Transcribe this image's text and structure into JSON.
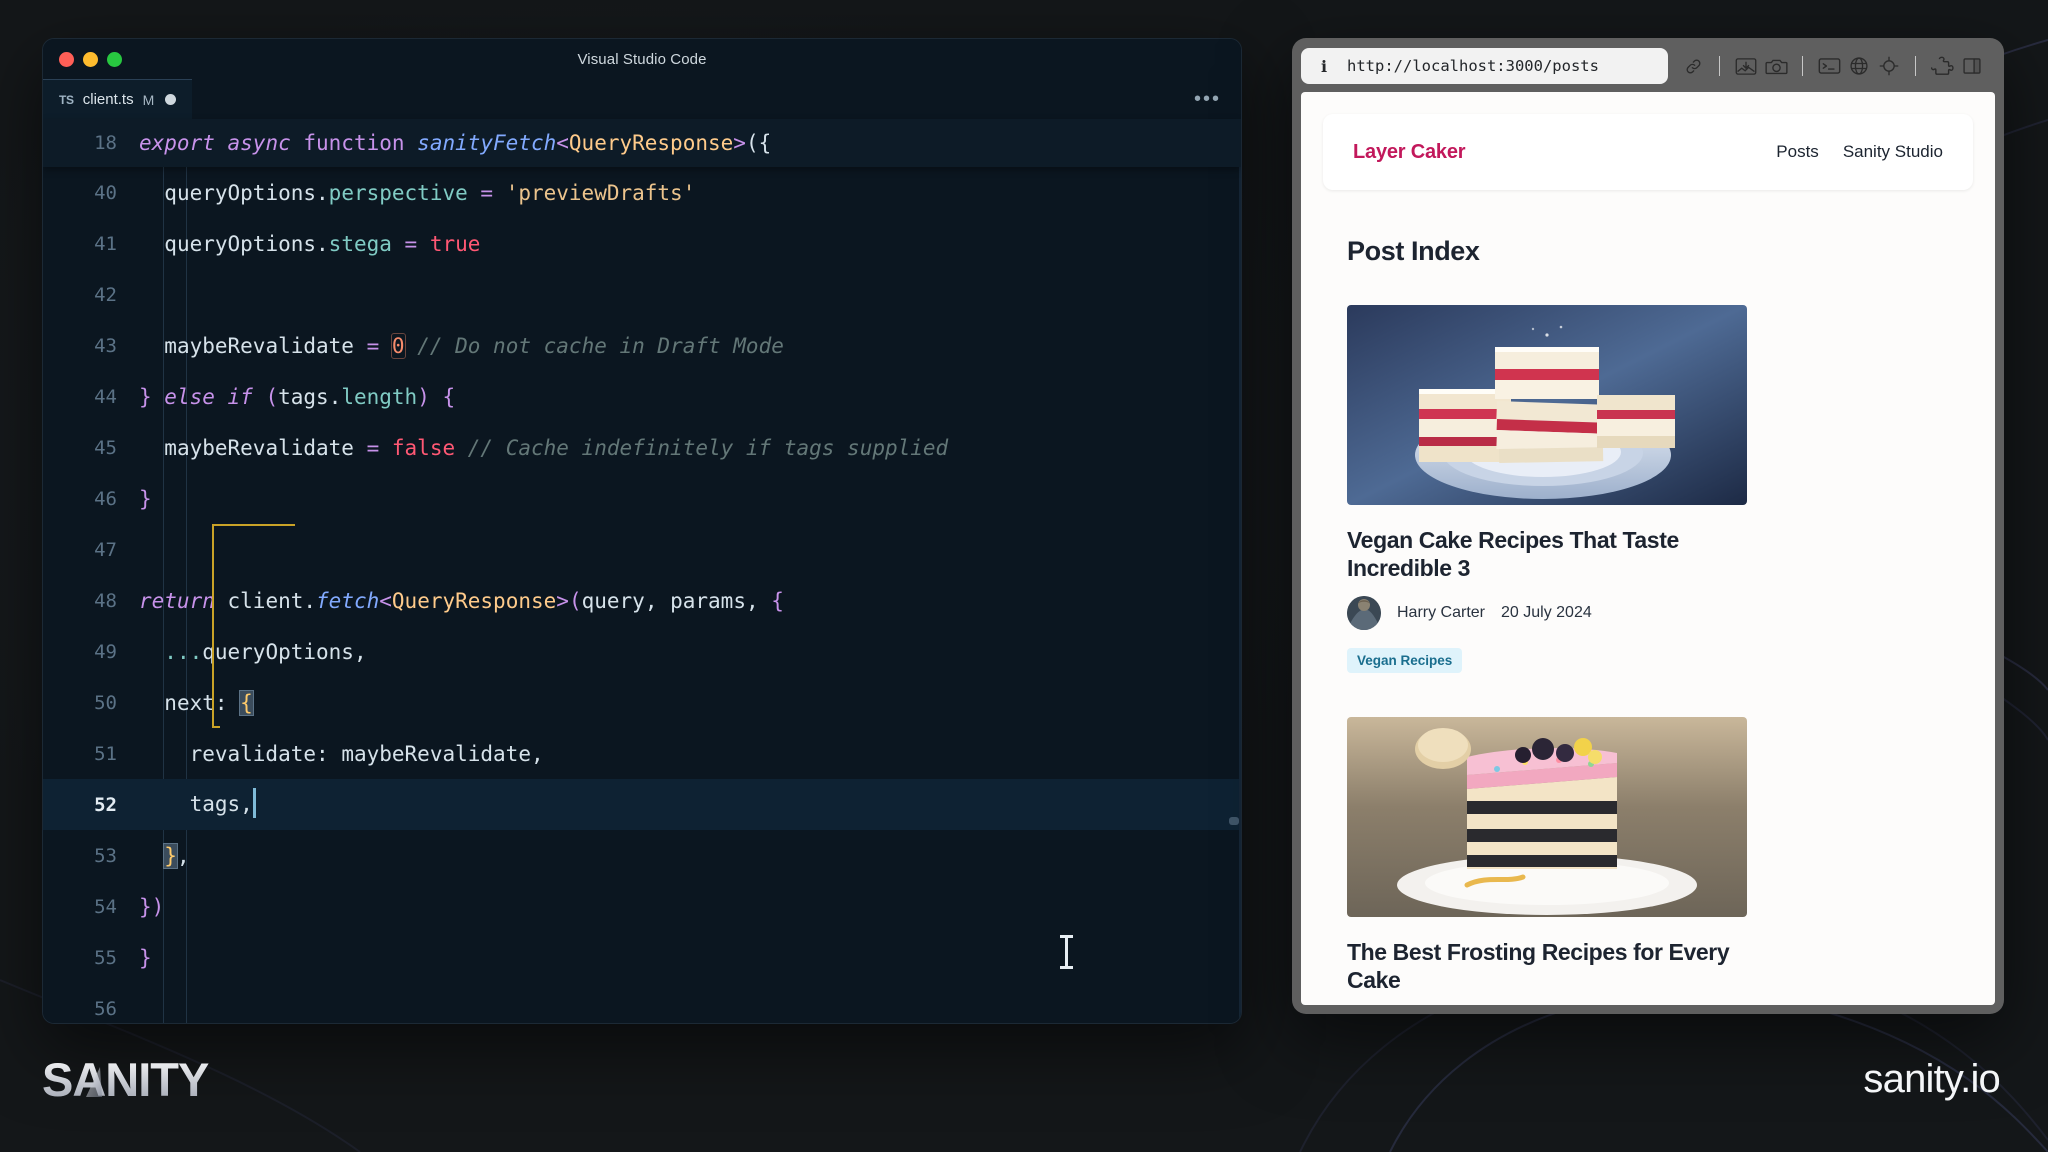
{
  "window": {
    "vscode_title": "Visual Studio Code",
    "traffic_lights": [
      "close-button",
      "minimize-button",
      "maximize-button"
    ],
    "tab": {
      "file_icon_label": "TS",
      "filename": "client.ts",
      "modified_badge": "M",
      "dirty_indicator": "●"
    },
    "tab_actions_label": "•••"
  },
  "editor": {
    "sticky": {
      "line_number": "18",
      "tokens": [
        {
          "t": "export ",
          "c": "k-kw"
        },
        {
          "t": "async ",
          "c": "k-kw"
        },
        {
          "t": "function ",
          "c": "k-kw2"
        },
        {
          "t": "sanityFetch",
          "c": "k-fn"
        },
        {
          "t": "<",
          "c": "k-pink"
        },
        {
          "t": "QueryResponse",
          "c": "k-type"
        },
        {
          "t": ">",
          "c": "k-pink"
        },
        {
          "t": "({",
          "c": "k-punct"
        }
      ]
    },
    "lines": [
      {
        "n": "40",
        "active": false,
        "tokens": [
          {
            "t": "  ",
            "c": "k-white"
          },
          {
            "t": "queryOptions",
            "c": "k-white"
          },
          {
            "t": ".",
            "c": "k-punct"
          },
          {
            "t": "perspective",
            "c": "k-member"
          },
          {
            "t": " = ",
            "c": "k-op"
          },
          {
            "t": "'previewDrafts'",
            "c": "k-str"
          }
        ]
      },
      {
        "n": "41",
        "active": false,
        "tokens": [
          {
            "t": "  ",
            "c": "k-white"
          },
          {
            "t": "queryOptions",
            "c": "k-white"
          },
          {
            "t": ".",
            "c": "k-punct"
          },
          {
            "t": "stega",
            "c": "k-member"
          },
          {
            "t": " = ",
            "c": "k-op"
          },
          {
            "t": "true",
            "c": "k-bool"
          }
        ]
      },
      {
        "n": "42",
        "active": false,
        "tokens": []
      },
      {
        "n": "43",
        "active": false,
        "tokens": [
          {
            "t": "  ",
            "c": "k-white"
          },
          {
            "t": "maybeRevalidate",
            "c": "k-white"
          },
          {
            "t": " = ",
            "c": "k-op"
          },
          {
            "t": "0",
            "c": "k-num num-box"
          },
          {
            "t": " ",
            "c": "k-white"
          },
          {
            "t": "// Do not cache in Draft Mode",
            "c": "k-cmt"
          }
        ]
      },
      {
        "n": "44",
        "active": false,
        "tokens": [
          {
            "t": "} ",
            "c": "k-pink"
          },
          {
            "t": "else ",
            "c": "k-kw"
          },
          {
            "t": "if ",
            "c": "k-kw"
          },
          {
            "t": "(",
            "c": "k-pink"
          },
          {
            "t": "tags",
            "c": "k-white"
          },
          {
            "t": ".",
            "c": "k-punct"
          },
          {
            "t": "length",
            "c": "k-member"
          },
          {
            "t": ") {",
            "c": "k-pink"
          }
        ]
      },
      {
        "n": "45",
        "active": false,
        "tokens": [
          {
            "t": "  ",
            "c": "k-white"
          },
          {
            "t": "maybeRevalidate",
            "c": "k-white"
          },
          {
            "t": " = ",
            "c": "k-op"
          },
          {
            "t": "false",
            "c": "k-bool"
          },
          {
            "t": " ",
            "c": "k-white"
          },
          {
            "t": "// Cache indefinitely if tags supplied",
            "c": "k-cmt"
          }
        ]
      },
      {
        "n": "46",
        "active": false,
        "tokens": [
          {
            "t": "}",
            "c": "k-pink"
          }
        ]
      },
      {
        "n": "47",
        "active": false,
        "tokens": []
      },
      {
        "n": "48",
        "active": false,
        "tokens": [
          {
            "t": "return ",
            "c": "k-kw"
          },
          {
            "t": "client",
            "c": "k-white"
          },
          {
            "t": ".",
            "c": "k-punct"
          },
          {
            "t": "fetch",
            "c": "k-fn"
          },
          {
            "t": "<",
            "c": "k-pink"
          },
          {
            "t": "QueryResponse",
            "c": "k-type"
          },
          {
            "t": ">",
            "c": "k-pink"
          },
          {
            "t": "(",
            "c": "k-pink"
          },
          {
            "t": "query",
            "c": "k-white"
          },
          {
            "t": ", ",
            "c": "k-punct"
          },
          {
            "t": "params",
            "c": "k-white"
          },
          {
            "t": ", ",
            "c": "k-punct"
          },
          {
            "t": "{",
            "c": "k-pink"
          }
        ]
      },
      {
        "n": "49",
        "active": false,
        "tokens": [
          {
            "t": "  ",
            "c": "k-white"
          },
          {
            "t": "...",
            "c": "k-dim"
          },
          {
            "t": "queryOptions",
            "c": "k-white"
          },
          {
            "t": ",",
            "c": "k-punct"
          }
        ]
      },
      {
        "n": "50",
        "active": false,
        "tokens": [
          {
            "t": "  ",
            "c": "k-white"
          },
          {
            "t": "next",
            "c": "k-white"
          },
          {
            "t": ": ",
            "c": "k-punct"
          },
          {
            "t": "{",
            "c": "brk-hl"
          }
        ]
      },
      {
        "n": "51",
        "active": false,
        "tokens": [
          {
            "t": "    ",
            "c": "k-white"
          },
          {
            "t": "revalidate",
            "c": "k-white"
          },
          {
            "t": ": ",
            "c": "k-punct"
          },
          {
            "t": "maybeRevalidate",
            "c": "k-white"
          },
          {
            "t": ",",
            "c": "k-punct"
          }
        ]
      },
      {
        "n": "52",
        "active": true,
        "caret": true,
        "tokens": [
          {
            "t": "    ",
            "c": "k-white"
          },
          {
            "t": "tags",
            "c": "k-white"
          },
          {
            "t": ",",
            "c": "k-punct"
          }
        ]
      },
      {
        "n": "53",
        "active": false,
        "tokens": [
          {
            "t": "  ",
            "c": "k-white"
          },
          {
            "t": "}",
            "c": "brk-hl"
          },
          {
            "t": ",",
            "c": "k-punct"
          }
        ]
      },
      {
        "n": "54",
        "active": false,
        "tokens": [
          {
            "t": "})",
            "c": "k-pink"
          }
        ]
      },
      {
        "n": "55",
        "active": false,
        "tokens": [
          {
            "t": "}",
            "c": "k-pink"
          }
        ]
      },
      {
        "n": "56",
        "active": false,
        "tokens": []
      }
    ]
  },
  "browser": {
    "url": "http://localhost:3000/posts",
    "info_glyph": "i",
    "tools": [
      {
        "name": "link-icon"
      },
      {
        "name": "separator"
      },
      {
        "name": "image-download-icon"
      },
      {
        "name": "camera-icon"
      },
      {
        "name": "separator"
      },
      {
        "name": "terminal-icon"
      },
      {
        "name": "globe-icon"
      },
      {
        "name": "crosshair-icon"
      },
      {
        "name": "separator"
      },
      {
        "name": "puzzle-icon"
      },
      {
        "name": "split-panel-icon"
      }
    ]
  },
  "site": {
    "brand": "Layer Caker",
    "nav": [
      "Posts",
      "Sanity Studio"
    ],
    "page_title": "Post Index",
    "posts": [
      {
        "title": "Vegan Cake Recipes That Taste Incredible 3",
        "author": "Harry Carter",
        "date": "20 July 2024",
        "tags": [
          "Vegan Recipes"
        ],
        "image_alt": "stacked-raspberry-layer-slices-on-blue-plate"
      },
      {
        "title": "The Best Frosting Recipes for Every Cake",
        "author": "",
        "date": "",
        "tags": [],
        "image_alt": "pink-frosted-layer-cake-slice-with-berries"
      }
    ]
  },
  "footer": {
    "logo_text": "SANITY",
    "domain_text": "sanity.io"
  },
  "colors": {
    "brand_pink": "#c2185b",
    "editor_bg": "#0b1620",
    "tag_bg": "#dff3fb",
    "tag_fg": "#1a6e8e"
  }
}
